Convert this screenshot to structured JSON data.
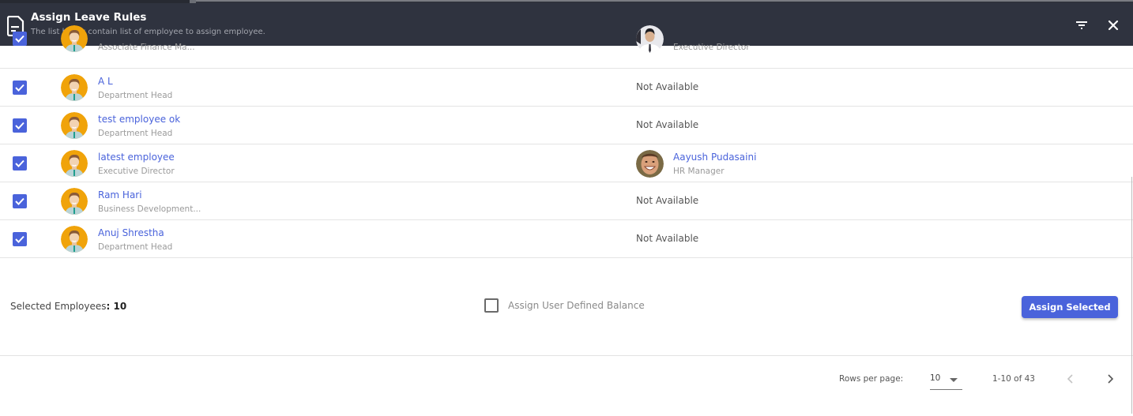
{
  "header": {
    "title": "Assign Leave Rules",
    "subtitle": "The list below contain list of employee to assign employee.",
    "icons": [
      "document-icon",
      "filter-icon",
      "close-icon"
    ]
  },
  "colors": {
    "header_bg": "#2f333f",
    "accent": "#4a63db",
    "avatar_bg": "#f0a30a"
  },
  "employees": [
    {
      "checked": true,
      "name": "",
      "role": "Associate Finance Ma...",
      "manager": {
        "available": true,
        "name": "",
        "role": "Executive Director",
        "avatar": "photo-suit"
      }
    },
    {
      "checked": true,
      "name": "A L",
      "role": "Department Head",
      "manager": {
        "available": false,
        "text": "Not Available"
      }
    },
    {
      "checked": true,
      "name": "test employee ok",
      "role": "Department Head",
      "manager": {
        "available": false,
        "text": "Not Available"
      }
    },
    {
      "checked": true,
      "name": "latest employee",
      "role": "Executive Director",
      "manager": {
        "available": true,
        "name": "Aayush Pudasaini",
        "role": "HR Manager",
        "avatar": "photo-smile"
      }
    },
    {
      "checked": true,
      "name": "Ram Hari",
      "role": "Business Development...",
      "manager": {
        "available": false,
        "text": "Not Available"
      }
    },
    {
      "checked": true,
      "name": "Anuj Shrestha",
      "role": "Department Head",
      "manager": {
        "available": false,
        "text": "Not Available"
      }
    }
  ],
  "footer": {
    "selected_label": "Selected Employees",
    "selected_count": "10",
    "user_defined_balance_label": "Assign User Defined Balance",
    "user_defined_balance_checked": false,
    "assign_button": "Assign Selected"
  },
  "pagination": {
    "rows_per_page_label": "Rows per page:",
    "rows_per_page_value": "10",
    "range_text": "1-10 of 43"
  }
}
